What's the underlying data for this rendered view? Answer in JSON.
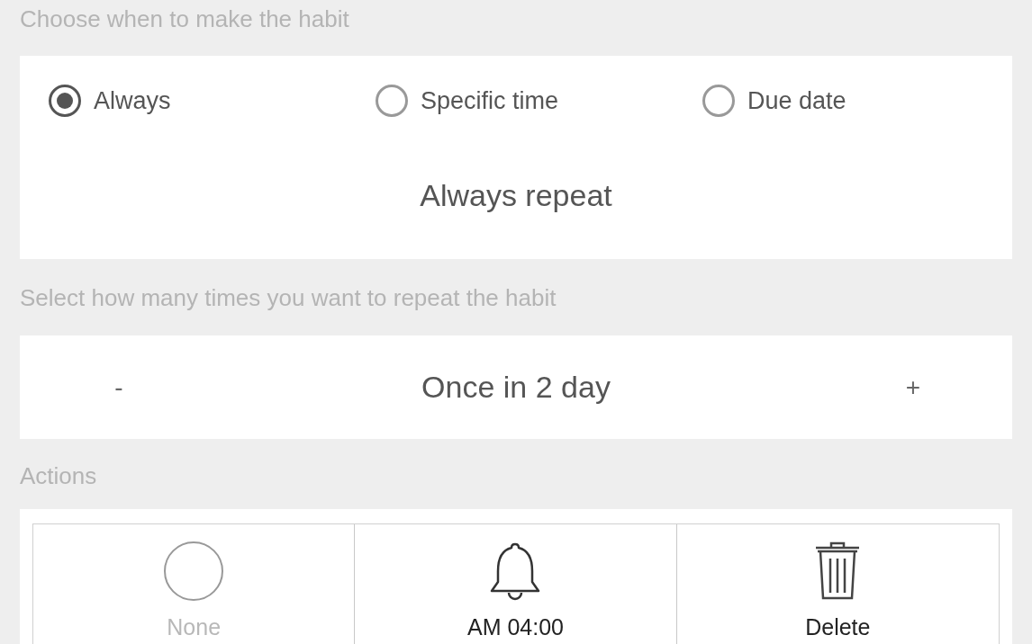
{
  "schedule": {
    "label": "Choose when to make the habit",
    "options": [
      {
        "label": "Always",
        "selected": true
      },
      {
        "label": "Specific time",
        "selected": false
      },
      {
        "label": "Due date",
        "selected": false
      }
    ],
    "summary": "Always repeat"
  },
  "repeat": {
    "label": "Select how many times you want to repeat the habit",
    "decrement": "-",
    "value": "Once in 2 day",
    "increment": "+"
  },
  "actions": {
    "label": "Actions",
    "items": [
      {
        "kind": "none",
        "label": "None",
        "disabled": true
      },
      {
        "kind": "reminder",
        "label": "AM 04:00",
        "disabled": false
      },
      {
        "kind": "delete",
        "label": "Delete",
        "disabled": false
      }
    ]
  }
}
